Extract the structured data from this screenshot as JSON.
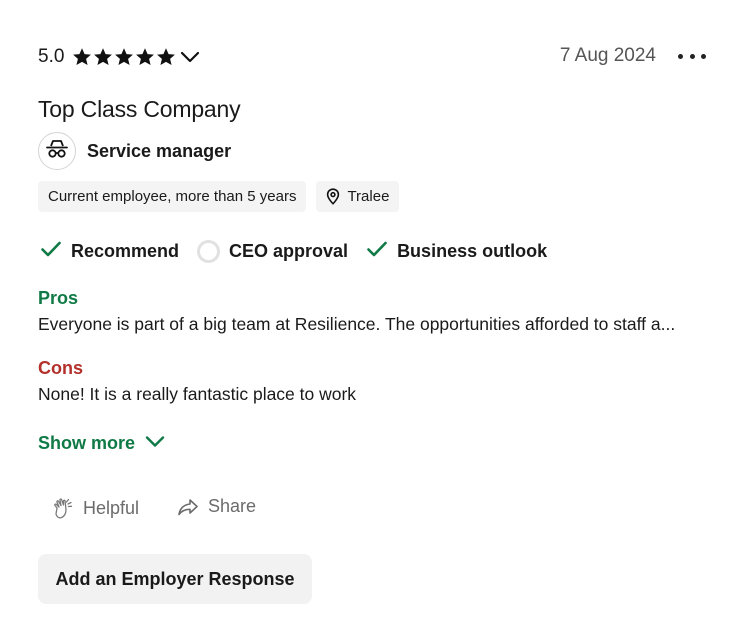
{
  "review": {
    "rating": "5.0",
    "stars_filled": 5,
    "stars_total": 5,
    "date": "7 Aug 2024",
    "title": "Top Class Company",
    "role": "Service manager",
    "employment": "Current employee, more than 5 years",
    "location": "Tralee",
    "approvals": [
      {
        "label": "Recommend",
        "state": "positive"
      },
      {
        "label": "CEO approval",
        "state": "neutral"
      },
      {
        "label": "Business outlook",
        "state": "positive"
      }
    ],
    "pros_heading": "Pros",
    "pros_text": "Everyone is part of a big team at Resilience. The opportunities afforded to staff a...",
    "cons_heading": "Cons",
    "cons_text": "None! It is a really fantastic place to work",
    "show_more": "Show more"
  },
  "actions": {
    "helpful": "Helpful",
    "share": "Share",
    "employer_response": "Add an Employer Response"
  },
  "colors": {
    "positive": "#0f7a45",
    "negative": "#b3302b",
    "neutral_ring": "#e1e1e1"
  },
  "icons": {
    "star": "star-icon",
    "chevron": "chevron-down-icon",
    "more": "more-horizontal-icon",
    "avatar": "incognito-icon",
    "location": "location-pin-icon",
    "check": "check-icon",
    "helpful": "clap-icon",
    "share": "share-arrow-icon"
  }
}
